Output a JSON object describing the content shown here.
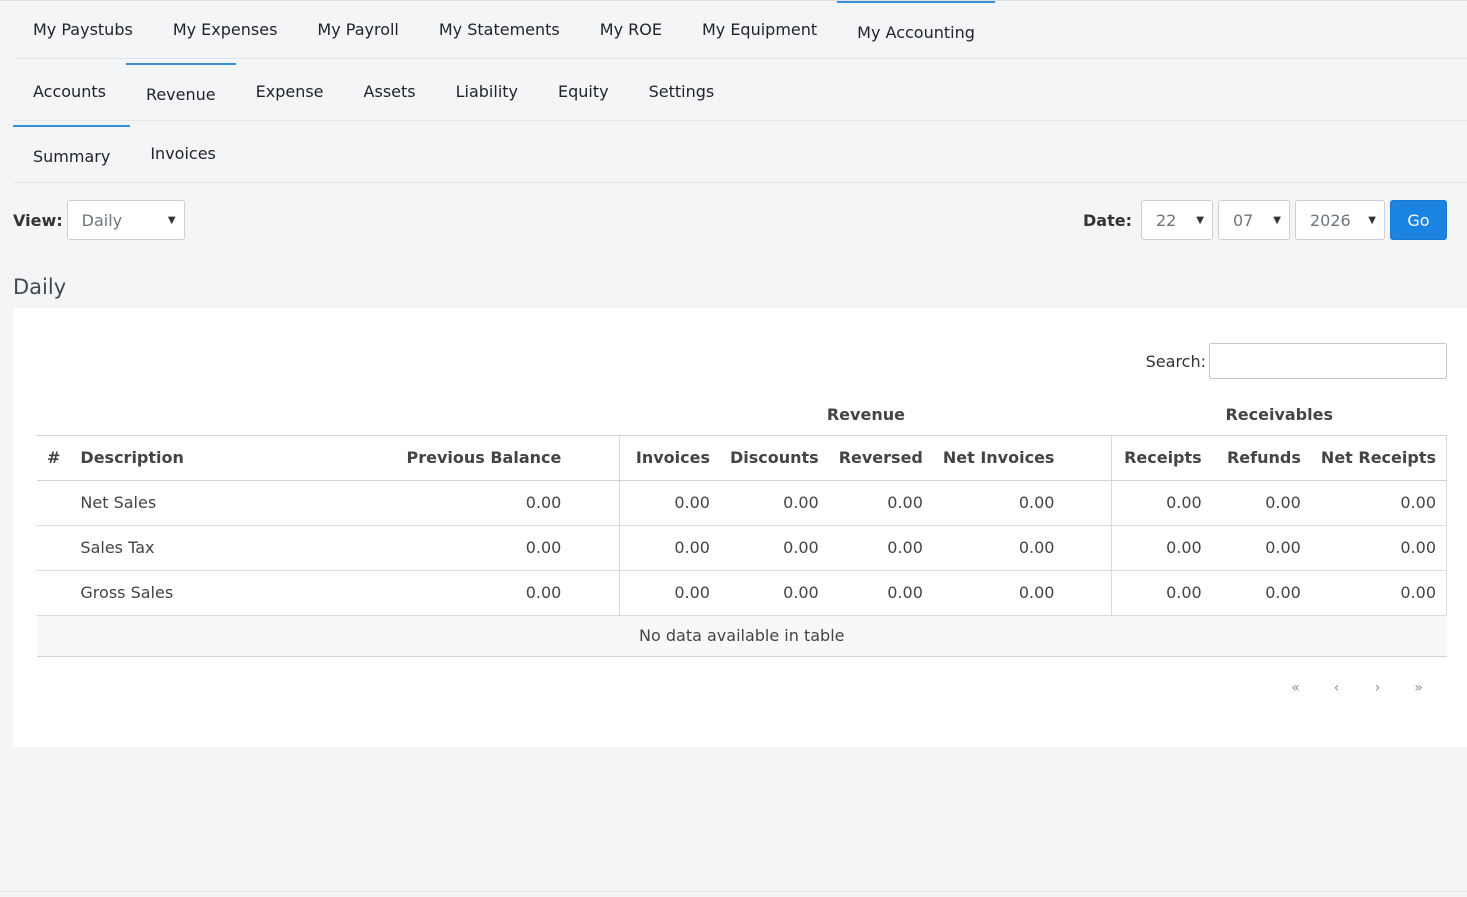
{
  "top_tabs": [
    "My Paystubs",
    "My Expenses",
    "My Payroll",
    "My Statements",
    "My ROE",
    "My Equipment",
    "My Accounting"
  ],
  "sub_tabs": [
    "Accounts",
    "Revenue",
    "Expense",
    "Assets",
    "Liability",
    "Equity",
    "Settings"
  ],
  "view_tabs": [
    "Summary",
    "Invoices"
  ],
  "view_filter": {
    "label": "View:",
    "value": "Daily"
  },
  "date_filter": {
    "label": "Date:",
    "day": "22",
    "month": "07",
    "year": "2026",
    "go_label": "Go"
  },
  "section_title": "Daily",
  "search": {
    "label": "Search:",
    "placeholder": ""
  },
  "table": {
    "group_headers": {
      "revenue": "Revenue",
      "receivables": "Receivables"
    },
    "columns": [
      "#",
      "Description",
      "Previous Balance",
      "Invoices",
      "Discounts",
      "Reversed",
      "Net Invoices",
      "Receipts",
      "Refunds",
      "Net Receipts"
    ],
    "rows": [
      {
        "num": "",
        "description": "Net Sales",
        "previous_balance": "0.00",
        "invoices": "0.00",
        "discounts": "0.00",
        "reversed": "0.00",
        "net_invoices": "0.00",
        "receipts": "0.00",
        "refunds": "0.00",
        "net_receipts": "0.00"
      },
      {
        "num": "",
        "description": "Sales Tax",
        "previous_balance": "0.00",
        "invoices": "0.00",
        "discounts": "0.00",
        "reversed": "0.00",
        "net_invoices": "0.00",
        "receipts": "0.00",
        "refunds": "0.00",
        "net_receipts": "0.00"
      },
      {
        "num": "",
        "description": "Gross Sales",
        "previous_balance": "0.00",
        "invoices": "0.00",
        "discounts": "0.00",
        "reversed": "0.00",
        "net_invoices": "0.00",
        "receipts": "0.00",
        "refunds": "0.00",
        "net_receipts": "0.00"
      }
    ],
    "empty_message": "No data available in table"
  },
  "pagination": {
    "first": "«",
    "prev": "‹",
    "next": "›",
    "last": "»"
  },
  "colors": {
    "accent": "#1b84e2",
    "active_tab_border": "#3a8fd9",
    "background": "#f4f5f7"
  }
}
